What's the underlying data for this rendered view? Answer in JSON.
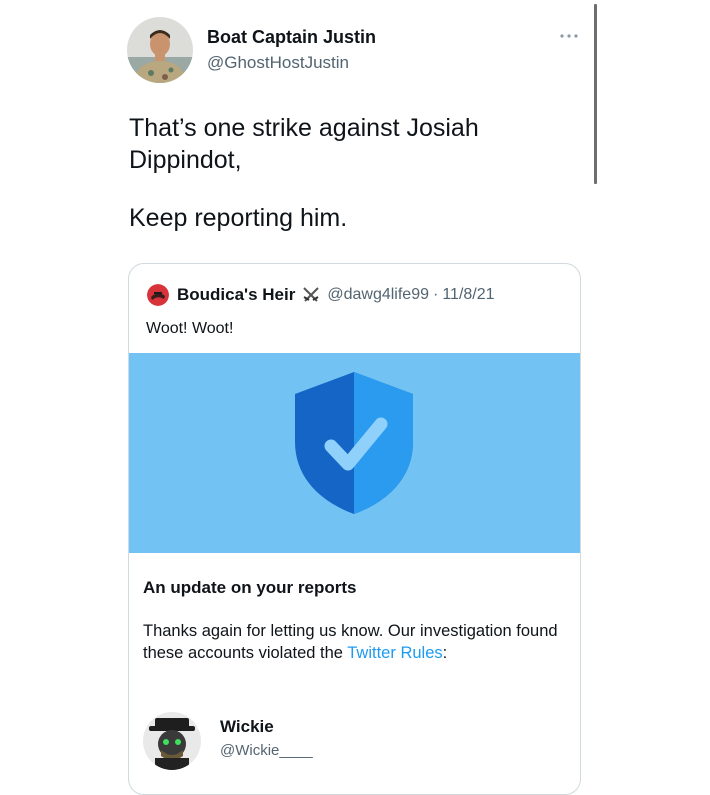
{
  "tweet": {
    "author_name": "Boat Captain Justin",
    "author_handle": "@GhostHostJustin",
    "text_line1": "That’s one strike against Josiah Dippindot,",
    "text_line2": "Keep reporting him.",
    "more_icon": "more-horizontal-icon"
  },
  "quote": {
    "author_name": "Boudica's Heir",
    "name_emoji_icon": "crossed-swords-icon",
    "author_handle": "@dawg4life99",
    "separator": "·",
    "date": "11/8/21",
    "text": "Woot! Woot!",
    "banner_icon": "shield-check-icon",
    "colors": {
      "banner_bg": "#72c3f3",
      "shield_dark": "#1565c7",
      "shield_light": "#2b9bf0",
      "link": "#1d9bf0"
    }
  },
  "update_card": {
    "title": "An update on your reports",
    "body_prefix": "Thanks again for letting us know. Our investigation found these accounts violated the ",
    "link_text": "Twitter Rules",
    "body_suffix": ":",
    "account": {
      "name": "Wickie",
      "handle": "@Wickie____"
    }
  }
}
